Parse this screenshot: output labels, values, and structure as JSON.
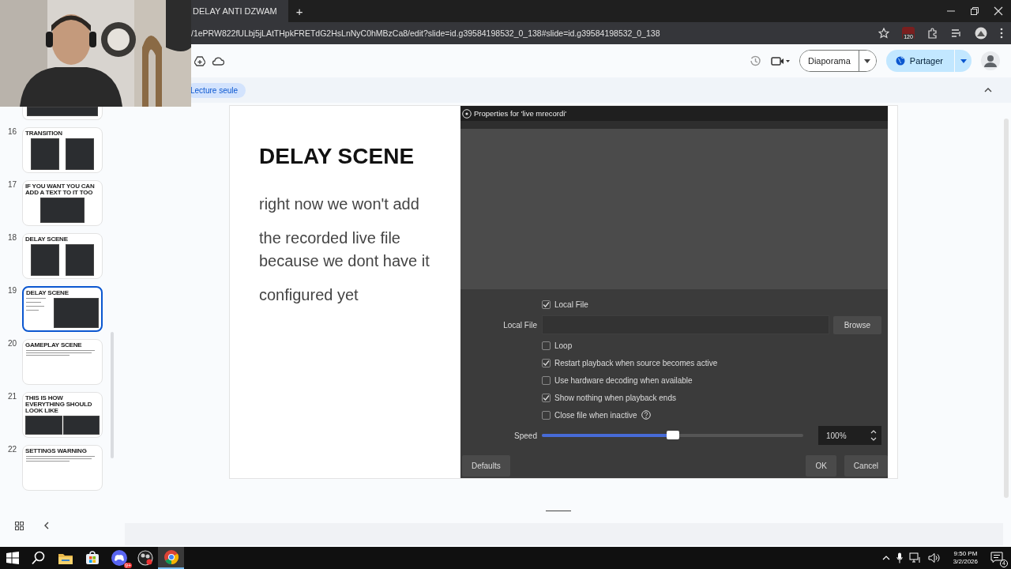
{
  "browser": {
    "tab_title": "DELAY ANTI DZWAM",
    "new_tab": "+",
    "url": "/1ePRW822fULbj5jLAtTHpkFRETdG2HsLnNyC0hMBzCa8/edit?slide=id.g39584198532_0_138#slide=id.g39584198532_0_138",
    "extension_badge": "120"
  },
  "toolbar": {
    "slideshow_button": "Diaporama",
    "share_button": "Partager"
  },
  "read_only_chip": "Lecture seule",
  "slides": [
    {
      "number": "16",
      "title": "TRANSITION",
      "kind": "two_screens",
      "selected": false
    },
    {
      "number": "17",
      "title": "IF YOU WANT YOU CAN ADD A TEXT TO IT TOO",
      "kind": "one_screen",
      "selected": false
    },
    {
      "number": "18",
      "title": "DELAY SCENE",
      "kind": "two_screens",
      "selected": false
    },
    {
      "number": "19",
      "title": "DELAY SCENE",
      "kind": "text_screen",
      "selected": true
    },
    {
      "number": "20",
      "title": "GAMEPLAY SCENE",
      "kind": "text",
      "selected": false
    },
    {
      "number": "21",
      "title": "THIS IS HOW EVERYTHING SHOULD LOOK LIKE",
      "kind": "wide_screens",
      "selected": false
    },
    {
      "number": "22",
      "title": "SETTINGS WARNING",
      "kind": "text",
      "selected": false
    }
  ],
  "slide": {
    "title": "DELAY SCENE",
    "paragraphs": [
      "right now we won't add",
      "the recorded live file because we dont have it",
      "configured yet"
    ],
    "dialog": {
      "title": "Properties for 'live mrecordi'",
      "settings": [
        {
          "kind": "checkbox",
          "label": "Local File",
          "checked": true
        },
        {
          "kind": "file",
          "label": "Local File",
          "button": "Browse"
        },
        {
          "kind": "checkbox",
          "label": "Loop",
          "checked": false
        },
        {
          "kind": "checkbox",
          "label": "Restart playback when source becomes active",
          "checked": true
        },
        {
          "kind": "checkbox",
          "label": "Use hardware decoding when available",
          "checked": false
        },
        {
          "kind": "checkbox",
          "label": "Show nothing when playback ends",
          "checked": true
        },
        {
          "kind": "checkbox",
          "label": "Close file when inactive",
          "checked": false,
          "help": true
        },
        {
          "kind": "slider",
          "label": "Speed",
          "level": 0.5,
          "value": "100%"
        }
      ],
      "left_buttons": [
        "Defaults"
      ],
      "right_buttons": [
        "OK",
        "Cancel"
      ]
    }
  },
  "taskbar": {
    "discord_badge": "9+",
    "time": "9:50 PM",
    "date": "3/2/2026",
    "notification_count": "4"
  }
}
